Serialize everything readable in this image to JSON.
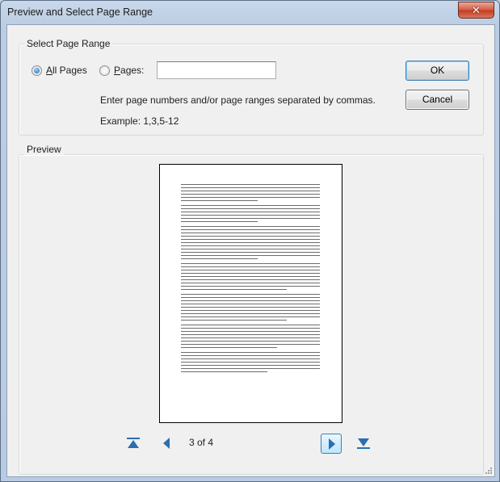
{
  "window": {
    "title": "Preview and Select Page Range",
    "close_glyph": "✕"
  },
  "range": {
    "legend": "Select Page Range",
    "all_pages_label": "All Pages",
    "pages_label": "Pages:",
    "pages_value": "",
    "selected": "all_pages",
    "instructions": "Enter page numbers and/or page ranges separated by commas.",
    "example": "Example: 1,3,5-12"
  },
  "buttons": {
    "ok": "OK",
    "cancel": "Cancel"
  },
  "preview": {
    "legend": "Preview",
    "page_indicator": "3 of 4",
    "icons": [
      "first-page-icon",
      "previous-page-icon",
      "next-page-icon",
      "last-page-icon"
    ]
  },
  "colors": {
    "accent": "#3c7fb1",
    "nav_icon": "#2a6fb0",
    "title_bar": "#bccde3",
    "close_button": "#c43e22"
  }
}
